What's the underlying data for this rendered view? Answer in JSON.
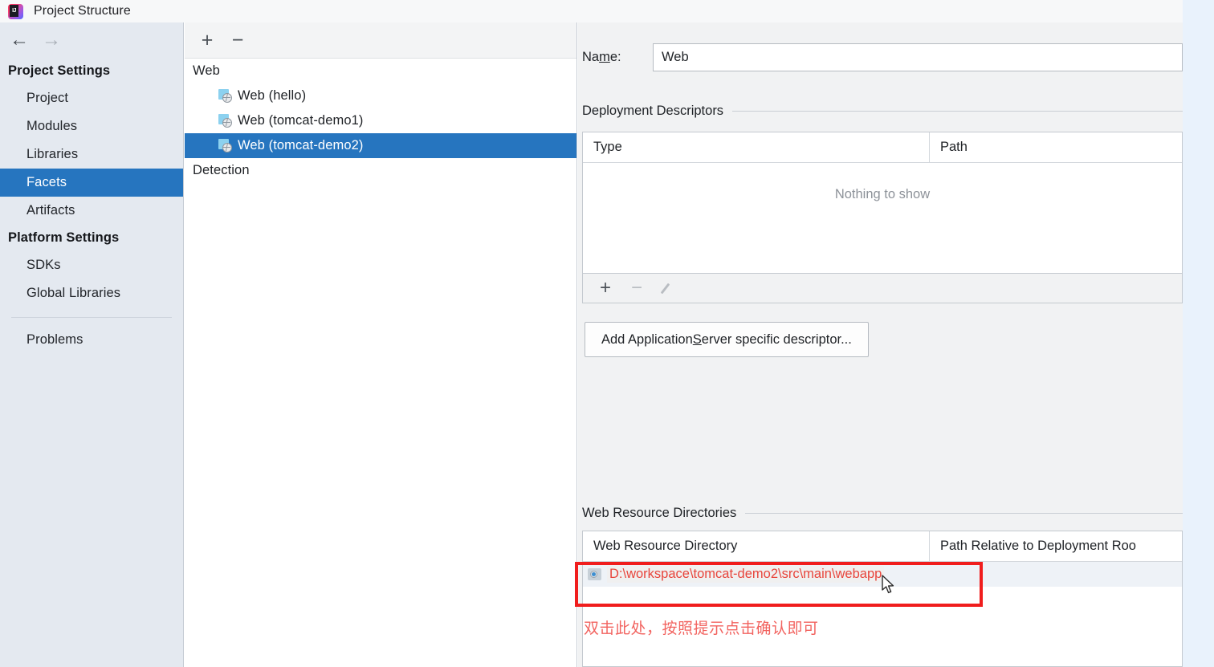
{
  "window": {
    "title": "Project Structure",
    "app_icon": "intellij-idea-icon"
  },
  "sidebar": {
    "back_icon": "arrow-left-icon",
    "forward_icon": "arrow-right-icon",
    "groups": [
      {
        "label": "Project Settings",
        "items": [
          {
            "label": "Project",
            "selected": false
          },
          {
            "label": "Modules",
            "selected": false
          },
          {
            "label": "Libraries",
            "selected": false
          },
          {
            "label": "Facets",
            "selected": true
          },
          {
            "label": "Artifacts",
            "selected": false
          }
        ]
      },
      {
        "label": "Platform Settings",
        "items": [
          {
            "label": "SDKs",
            "selected": false
          },
          {
            "label": "Global Libraries",
            "selected": false
          }
        ]
      }
    ],
    "extra_items": [
      {
        "label": "Problems",
        "selected": false
      }
    ]
  },
  "tree_panel": {
    "toolbar": {
      "add_label": "+",
      "remove_label": "−",
      "add_icon": "plus-icon",
      "remove_icon": "minus-icon"
    },
    "rows": [
      {
        "label": "Web",
        "type": "group",
        "selected": false
      },
      {
        "label": "Web (hello)",
        "type": "facet",
        "selected": false
      },
      {
        "label": "Web (tomcat-demo1)",
        "type": "facet",
        "selected": false
      },
      {
        "label": "Web (tomcat-demo2)",
        "type": "facet",
        "selected": true
      },
      {
        "label": "Detection",
        "type": "group",
        "selected": false
      }
    ]
  },
  "detail": {
    "name_field": {
      "label_before": "Na",
      "label_mnemonic": "m",
      "label_after": "e:",
      "value": "Web",
      "placeholder": ""
    },
    "deployment_descriptors": {
      "section_title": "Deployment Descriptors",
      "columns": [
        "Type",
        "Path"
      ],
      "rows": [],
      "empty_message": "Nothing to show",
      "toolbar": {
        "add_label": "+",
        "remove_label": "−",
        "add_icon": "plus-icon",
        "remove_icon": "minus-icon",
        "edit_icon": "pencil-icon"
      },
      "add_descriptor_button": {
        "text_before": "Add Application ",
        "mnemonic": "S",
        "text_after": "erver specific descriptor..."
      }
    },
    "web_resource_directories": {
      "section_title": "Web Resource Directories",
      "columns": [
        "Web Resource Directory",
        "Path Relative to Deployment Roo"
      ],
      "rows": [
        {
          "directory": "D:\\workspace\\tomcat-demo2\\src\\main\\webapp",
          "relative_path": "",
          "icon": "web-directory-icon",
          "highlighted": true
        }
      ]
    }
  },
  "annotations": {
    "note_text": "双击此处，按照提示点击确认即可",
    "note_color": "#f2635f",
    "highlight_box_color": "#f01d1d",
    "cursor_icon": "mouse-pointer-icon"
  },
  "colors": {
    "selection_blue": "#2675bf",
    "sidebar_bg": "#e4e9f0",
    "panel_bg": "#f1f2f3",
    "gutter_blue": "#e9f2fc",
    "path_red": "#e8453c"
  }
}
